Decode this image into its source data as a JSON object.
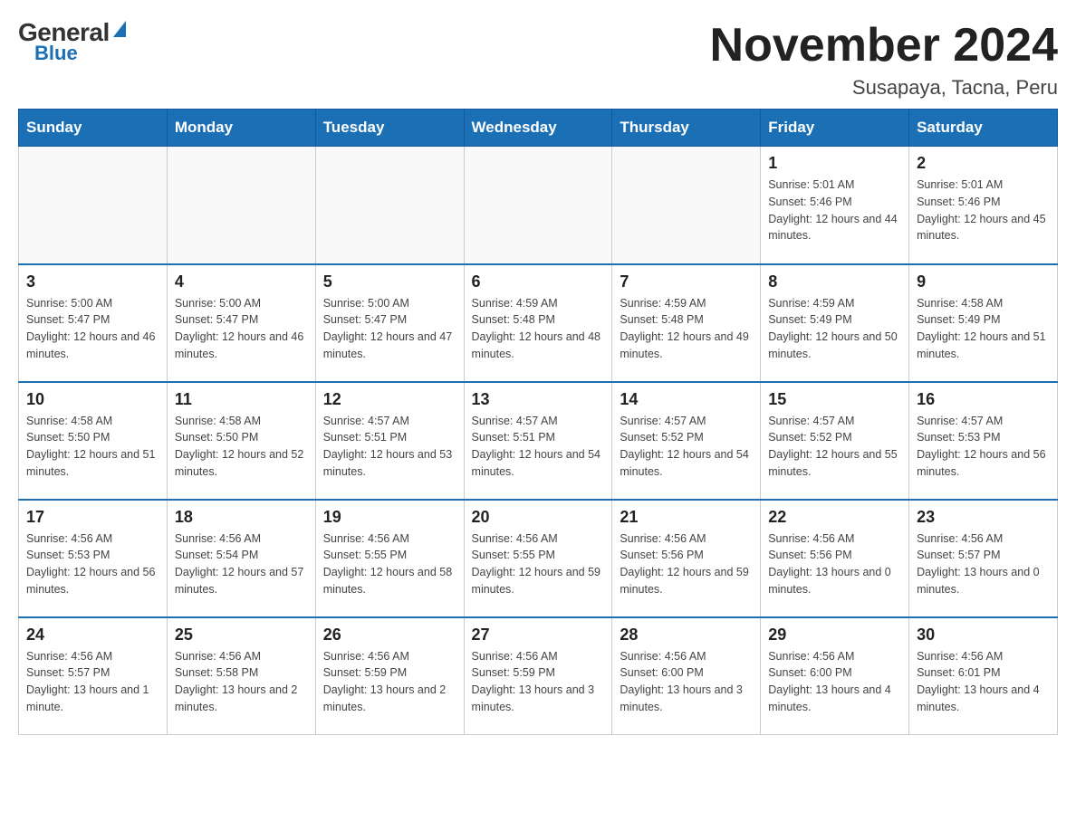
{
  "header": {
    "logo_general": "General",
    "logo_triangle": "",
    "logo_blue": "Blue",
    "month_title": "November 2024",
    "location": "Susapaya, Tacna, Peru"
  },
  "days_of_week": [
    "Sunday",
    "Monday",
    "Tuesday",
    "Wednesday",
    "Thursday",
    "Friday",
    "Saturday"
  ],
  "weeks": [
    [
      {
        "day": "",
        "sunrise": "",
        "sunset": "",
        "daylight": "",
        "empty": true
      },
      {
        "day": "",
        "sunrise": "",
        "sunset": "",
        "daylight": "",
        "empty": true
      },
      {
        "day": "",
        "sunrise": "",
        "sunset": "",
        "daylight": "",
        "empty": true
      },
      {
        "day": "",
        "sunrise": "",
        "sunset": "",
        "daylight": "",
        "empty": true
      },
      {
        "day": "",
        "sunrise": "",
        "sunset": "",
        "daylight": "",
        "empty": true
      },
      {
        "day": "1",
        "sunrise": "Sunrise: 5:01 AM",
        "sunset": "Sunset: 5:46 PM",
        "daylight": "Daylight: 12 hours and 44 minutes.",
        "empty": false
      },
      {
        "day": "2",
        "sunrise": "Sunrise: 5:01 AM",
        "sunset": "Sunset: 5:46 PM",
        "daylight": "Daylight: 12 hours and 45 minutes.",
        "empty": false
      }
    ],
    [
      {
        "day": "3",
        "sunrise": "Sunrise: 5:00 AM",
        "sunset": "Sunset: 5:47 PM",
        "daylight": "Daylight: 12 hours and 46 minutes.",
        "empty": false
      },
      {
        "day": "4",
        "sunrise": "Sunrise: 5:00 AM",
        "sunset": "Sunset: 5:47 PM",
        "daylight": "Daylight: 12 hours and 46 minutes.",
        "empty": false
      },
      {
        "day": "5",
        "sunrise": "Sunrise: 5:00 AM",
        "sunset": "Sunset: 5:47 PM",
        "daylight": "Daylight: 12 hours and 47 minutes.",
        "empty": false
      },
      {
        "day": "6",
        "sunrise": "Sunrise: 4:59 AM",
        "sunset": "Sunset: 5:48 PM",
        "daylight": "Daylight: 12 hours and 48 minutes.",
        "empty": false
      },
      {
        "day": "7",
        "sunrise": "Sunrise: 4:59 AM",
        "sunset": "Sunset: 5:48 PM",
        "daylight": "Daylight: 12 hours and 49 minutes.",
        "empty": false
      },
      {
        "day": "8",
        "sunrise": "Sunrise: 4:59 AM",
        "sunset": "Sunset: 5:49 PM",
        "daylight": "Daylight: 12 hours and 50 minutes.",
        "empty": false
      },
      {
        "day": "9",
        "sunrise": "Sunrise: 4:58 AM",
        "sunset": "Sunset: 5:49 PM",
        "daylight": "Daylight: 12 hours and 51 minutes.",
        "empty": false
      }
    ],
    [
      {
        "day": "10",
        "sunrise": "Sunrise: 4:58 AM",
        "sunset": "Sunset: 5:50 PM",
        "daylight": "Daylight: 12 hours and 51 minutes.",
        "empty": false
      },
      {
        "day": "11",
        "sunrise": "Sunrise: 4:58 AM",
        "sunset": "Sunset: 5:50 PM",
        "daylight": "Daylight: 12 hours and 52 minutes.",
        "empty": false
      },
      {
        "day": "12",
        "sunrise": "Sunrise: 4:57 AM",
        "sunset": "Sunset: 5:51 PM",
        "daylight": "Daylight: 12 hours and 53 minutes.",
        "empty": false
      },
      {
        "day": "13",
        "sunrise": "Sunrise: 4:57 AM",
        "sunset": "Sunset: 5:51 PM",
        "daylight": "Daylight: 12 hours and 54 minutes.",
        "empty": false
      },
      {
        "day": "14",
        "sunrise": "Sunrise: 4:57 AM",
        "sunset": "Sunset: 5:52 PM",
        "daylight": "Daylight: 12 hours and 54 minutes.",
        "empty": false
      },
      {
        "day": "15",
        "sunrise": "Sunrise: 4:57 AM",
        "sunset": "Sunset: 5:52 PM",
        "daylight": "Daylight: 12 hours and 55 minutes.",
        "empty": false
      },
      {
        "day": "16",
        "sunrise": "Sunrise: 4:57 AM",
        "sunset": "Sunset: 5:53 PM",
        "daylight": "Daylight: 12 hours and 56 minutes.",
        "empty": false
      }
    ],
    [
      {
        "day": "17",
        "sunrise": "Sunrise: 4:56 AM",
        "sunset": "Sunset: 5:53 PM",
        "daylight": "Daylight: 12 hours and 56 minutes.",
        "empty": false
      },
      {
        "day": "18",
        "sunrise": "Sunrise: 4:56 AM",
        "sunset": "Sunset: 5:54 PM",
        "daylight": "Daylight: 12 hours and 57 minutes.",
        "empty": false
      },
      {
        "day": "19",
        "sunrise": "Sunrise: 4:56 AM",
        "sunset": "Sunset: 5:55 PM",
        "daylight": "Daylight: 12 hours and 58 minutes.",
        "empty": false
      },
      {
        "day": "20",
        "sunrise": "Sunrise: 4:56 AM",
        "sunset": "Sunset: 5:55 PM",
        "daylight": "Daylight: 12 hours and 59 minutes.",
        "empty": false
      },
      {
        "day": "21",
        "sunrise": "Sunrise: 4:56 AM",
        "sunset": "Sunset: 5:56 PM",
        "daylight": "Daylight: 12 hours and 59 minutes.",
        "empty": false
      },
      {
        "day": "22",
        "sunrise": "Sunrise: 4:56 AM",
        "sunset": "Sunset: 5:56 PM",
        "daylight": "Daylight: 13 hours and 0 minutes.",
        "empty": false
      },
      {
        "day": "23",
        "sunrise": "Sunrise: 4:56 AM",
        "sunset": "Sunset: 5:57 PM",
        "daylight": "Daylight: 13 hours and 0 minutes.",
        "empty": false
      }
    ],
    [
      {
        "day": "24",
        "sunrise": "Sunrise: 4:56 AM",
        "sunset": "Sunset: 5:57 PM",
        "daylight": "Daylight: 13 hours and 1 minute.",
        "empty": false
      },
      {
        "day": "25",
        "sunrise": "Sunrise: 4:56 AM",
        "sunset": "Sunset: 5:58 PM",
        "daylight": "Daylight: 13 hours and 2 minutes.",
        "empty": false
      },
      {
        "day": "26",
        "sunrise": "Sunrise: 4:56 AM",
        "sunset": "Sunset: 5:59 PM",
        "daylight": "Daylight: 13 hours and 2 minutes.",
        "empty": false
      },
      {
        "day": "27",
        "sunrise": "Sunrise: 4:56 AM",
        "sunset": "Sunset: 5:59 PM",
        "daylight": "Daylight: 13 hours and 3 minutes.",
        "empty": false
      },
      {
        "day": "28",
        "sunrise": "Sunrise: 4:56 AM",
        "sunset": "Sunset: 6:00 PM",
        "daylight": "Daylight: 13 hours and 3 minutes.",
        "empty": false
      },
      {
        "day": "29",
        "sunrise": "Sunrise: 4:56 AM",
        "sunset": "Sunset: 6:00 PM",
        "daylight": "Daylight: 13 hours and 4 minutes.",
        "empty": false
      },
      {
        "day": "30",
        "sunrise": "Sunrise: 4:56 AM",
        "sunset": "Sunset: 6:01 PM",
        "daylight": "Daylight: 13 hours and 4 minutes.",
        "empty": false
      }
    ]
  ]
}
